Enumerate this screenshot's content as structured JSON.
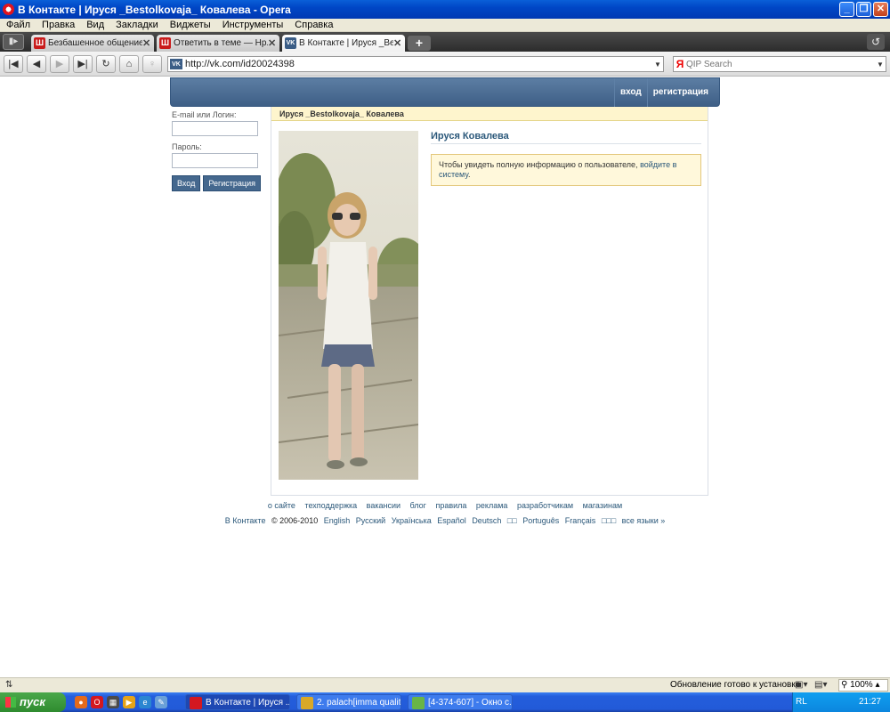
{
  "window": {
    "title": "В Контакте | Ируся _Bestolkovaja_ Ковалева - Opera"
  },
  "menu": [
    "Файл",
    "Правка",
    "Вид",
    "Закладки",
    "Виджеты",
    "Инструменты",
    "Справка"
  ],
  "tabs": [
    {
      "label": "Безбашенное общение ...",
      "icon": "red-site-icon",
      "active": false
    },
    {
      "label": "Ответить в теме — Нр...",
      "icon": "red-site-icon",
      "active": false
    },
    {
      "label": "В Контакте | Ируся _Ве...",
      "icon": "vk-icon",
      "active": true
    }
  ],
  "nav": {
    "url": "http://vk.com/id20024398",
    "search_placeholder": "QIP Search",
    "search_engine_letter": "Я"
  },
  "vk": {
    "header_links": {
      "login": "вход",
      "register": "регистрация"
    },
    "login_form": {
      "email_label": "E-mail или Логин:",
      "password_label": "Пароль:",
      "login_button": "Вход",
      "register_button": "Регистрация"
    },
    "profile": {
      "bar_title": "Ируся _Bestolkovaja_ Ковалева",
      "name": "Ируся Ковалева",
      "notice_text": "Чтобы увидеть полную информацию о пользователе, ",
      "notice_link": "войдите в систему",
      "notice_end": "."
    },
    "footer": {
      "links": [
        "о сайте",
        "техподдержка",
        "вакансии",
        "блог",
        "правила",
        "реклама",
        "разработчикам",
        "магазинам"
      ],
      "brand": "В Контакте",
      "copyright": "© 2006-2010",
      "languages": [
        "English",
        "Русский",
        "Українська",
        "Español",
        "Deutsch",
        "□□",
        "Português",
        "Français",
        "□□□",
        "все языки »"
      ]
    }
  },
  "status": {
    "text": "Обновление готово к установке",
    "zoom": "100%"
  },
  "taskbar": {
    "start_label": "пуск",
    "tasks": [
      "В Контакте | Ируся ...",
      "2. palach[imma qualit...",
      "[4-374-607] - Окно с..."
    ],
    "lang": "RL",
    "clock": "21:27"
  },
  "colors": {
    "vk_blue": "#45688e",
    "vk_link": "#2b587a",
    "notice_bg": "#fff8db",
    "profile_bar": "#fef5cd"
  }
}
